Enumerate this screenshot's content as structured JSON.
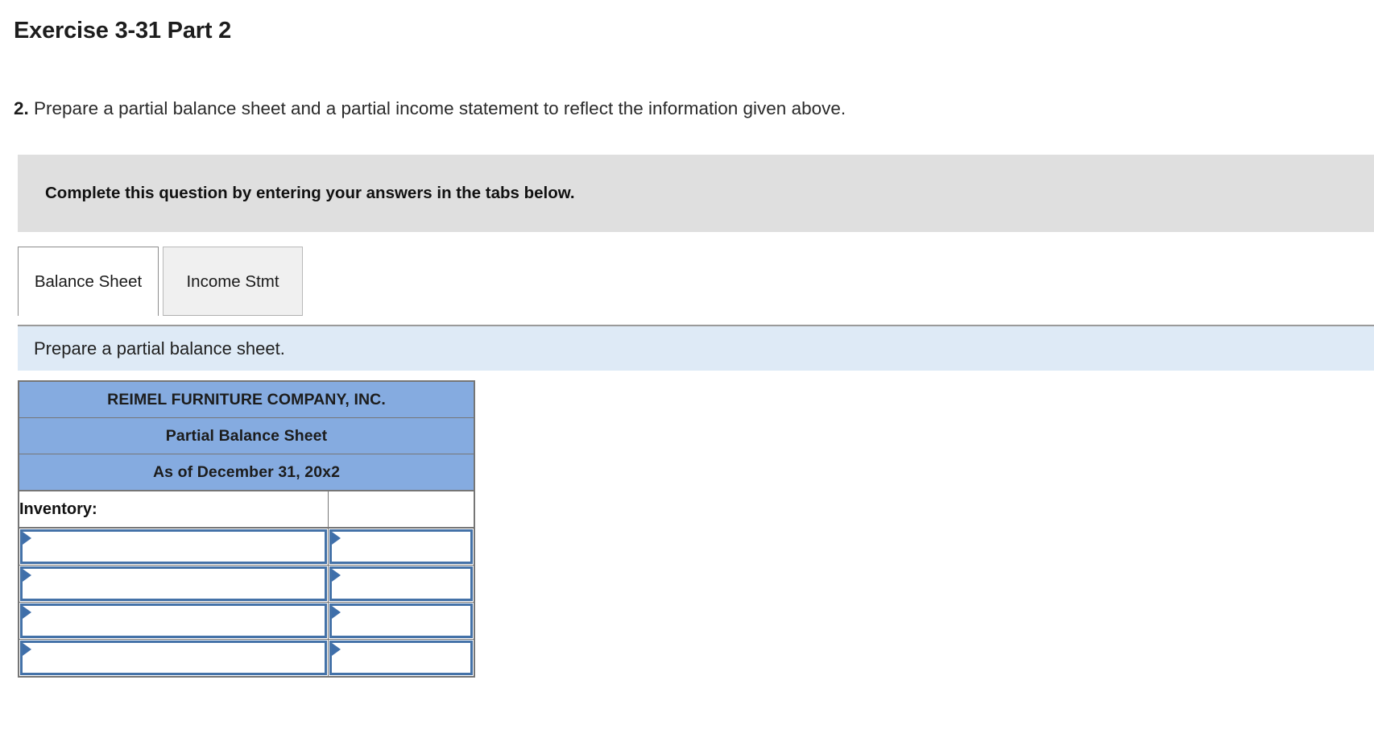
{
  "header": {
    "title": "Exercise 3-31 Part 2"
  },
  "question": {
    "number": "2.",
    "text": "Prepare a partial balance sheet and a partial income statement to reflect the information given above."
  },
  "instruction_banner": {
    "text": "Complete this question by entering your answers in the tabs below."
  },
  "tabs": {
    "items": [
      {
        "label": "Balance Sheet",
        "active": true
      },
      {
        "label": "Income Stmt",
        "active": false
      }
    ],
    "active_label": "Balance Sheet",
    "inactive_label": "Income Stmt"
  },
  "subinstruction": {
    "text": "Prepare a partial balance sheet."
  },
  "balance_sheet": {
    "headers": [
      "REIMEL FURNITURE COMPANY, INC.",
      "Partial Balance Sheet",
      "As of December 31, 20x2"
    ],
    "header_company": "REIMEL FURNITURE COMPANY, INC.",
    "header_statement": "Partial Balance Sheet",
    "header_date": "As of December 31, 20x2",
    "section_label": "Inventory:",
    "section_value": "",
    "rows": [
      {
        "label": "",
        "amount": ""
      },
      {
        "label": "",
        "amount": ""
      },
      {
        "label": "",
        "amount": ""
      },
      {
        "label": "",
        "amount": ""
      }
    ]
  },
  "colors": {
    "header_blue": "#85abe0",
    "subinstruction_blue": "#deeaf6",
    "banner_gray": "#dfdfdf",
    "input_border_blue": "#4472a8",
    "marker_blue": "#3f6faa",
    "table_border_gray": "#767676"
  },
  "icons": {
    "input_marker": "triangle-right-icon"
  }
}
